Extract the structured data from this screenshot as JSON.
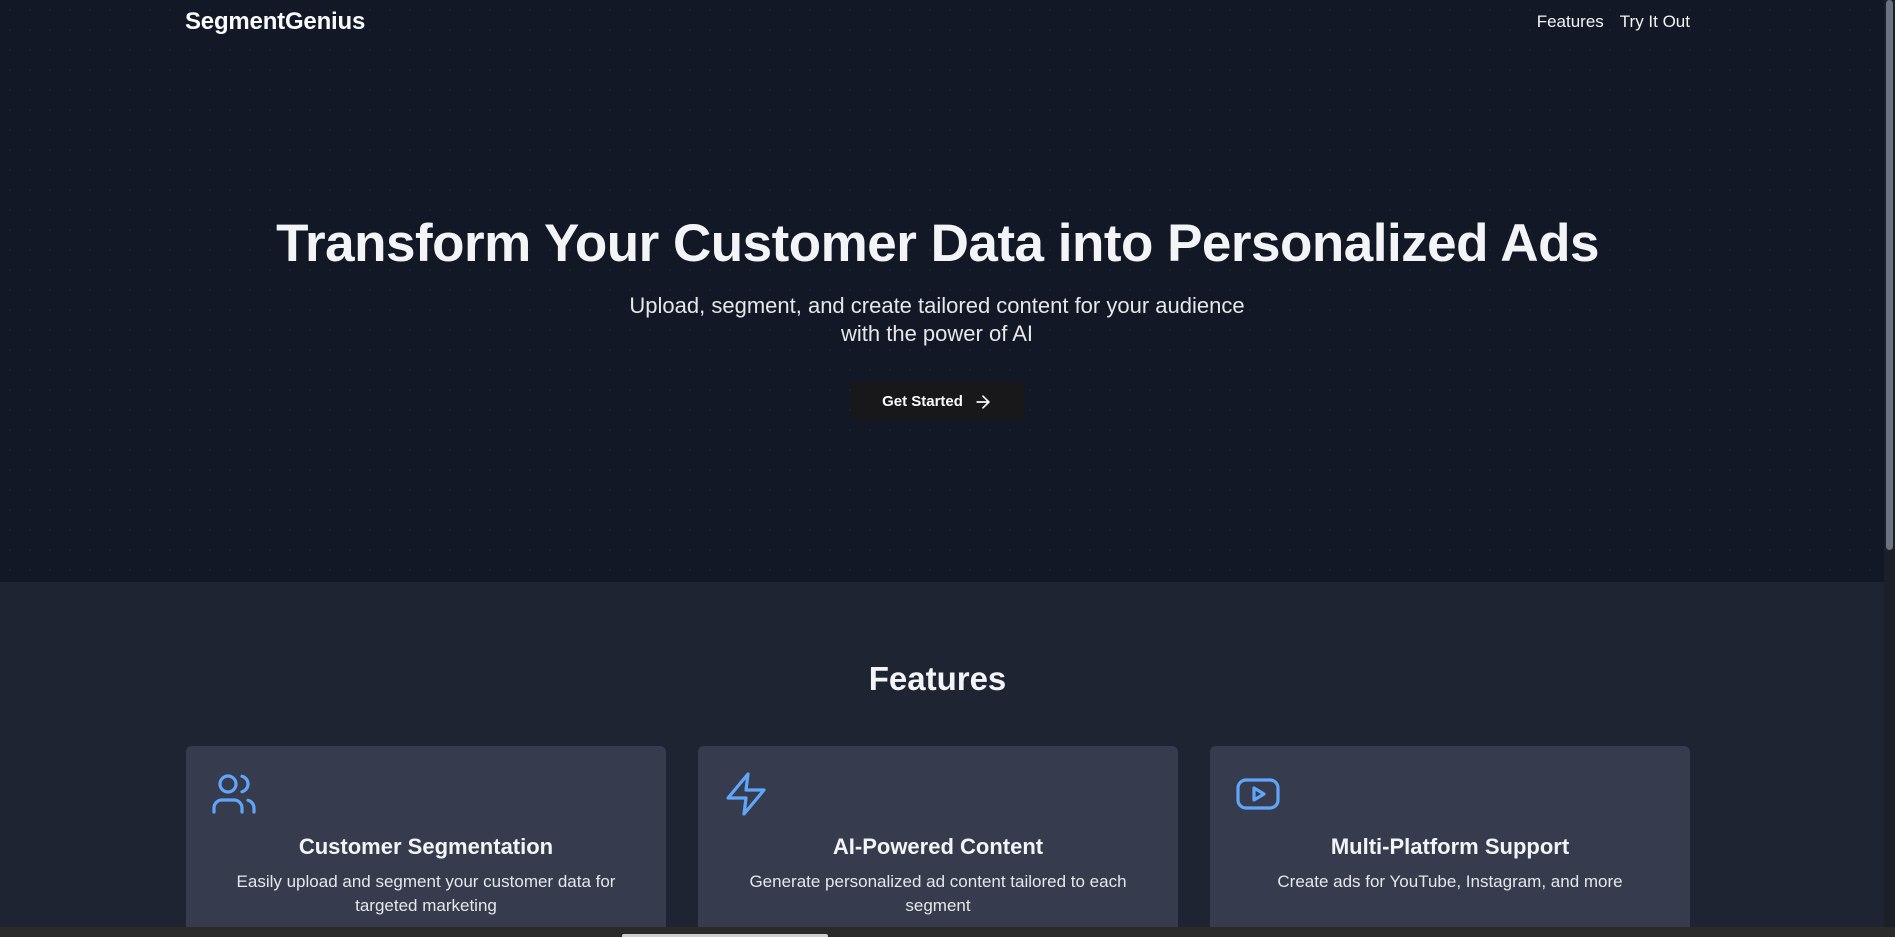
{
  "brand": {
    "name": "SegmentGenius"
  },
  "nav": {
    "links": [
      {
        "label": "Features"
      },
      {
        "label": "Try It Out"
      }
    ]
  },
  "hero": {
    "title": "Transform Your Customer Data into Personalized Ads",
    "subtitle": "Upload, segment, and create tailored content for your audience with the power of AI",
    "cta_label": "Get Started",
    "cta_icon": "arrow-right-icon"
  },
  "features": {
    "heading": "Features",
    "items": [
      {
        "icon": "users-icon",
        "title": "Customer Segmentation",
        "description": "Easily upload and segment your customer data for targeted marketing"
      },
      {
        "icon": "lightning-icon",
        "title": "AI-Powered Content",
        "description": "Generate personalized ad content tailored to each segment"
      },
      {
        "icon": "youtube-icon",
        "title": "Multi-Platform Support",
        "description": "Create ads for YouTube, Instagram, and more"
      }
    ]
  },
  "colors": {
    "hero_bg": "#121826",
    "features_bg": "#1f2433",
    "card_bg": "#363c4d",
    "accent_icon": "#60a5fa",
    "cta_bg": "#18181b"
  }
}
